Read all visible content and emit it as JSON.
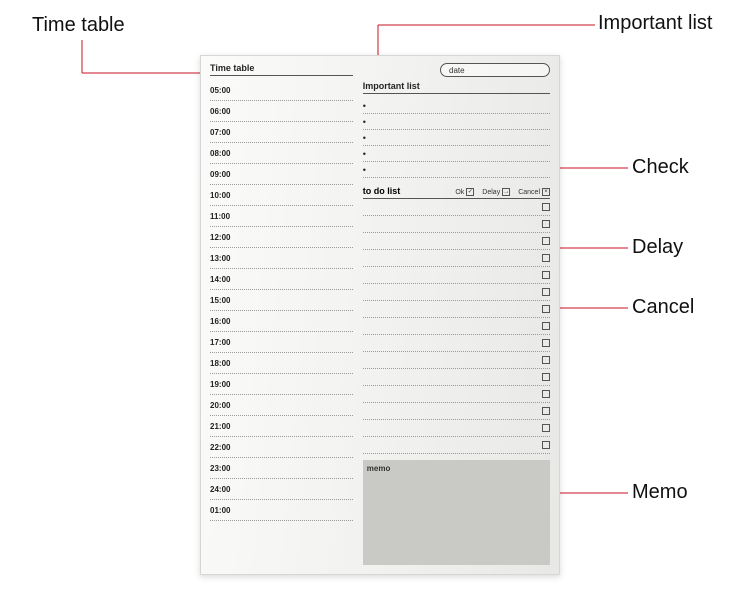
{
  "annotations": {
    "timetable": "Time table",
    "important": "Important list",
    "check": "Check",
    "delay": "Delay",
    "cancel": "Cancel",
    "memo": "Memo"
  },
  "planner": {
    "date_label": "date",
    "timetable": {
      "title": "Time table",
      "hours": [
        "05:00",
        "06:00",
        "07:00",
        "08:00",
        "09:00",
        "10:00",
        "11:00",
        "12:00",
        "13:00",
        "14:00",
        "15:00",
        "16:00",
        "17:00",
        "18:00",
        "19:00",
        "20:00",
        "21:00",
        "22:00",
        "23:00",
        "24:00",
        "01:00"
      ]
    },
    "important": {
      "title": "Important list",
      "rows": 5
    },
    "todo": {
      "title": "to do list",
      "legend": {
        "ok": "Ok",
        "delay": "Delay",
        "cancel": "Cancel"
      },
      "symbols": {
        "ok": "✓",
        "delay": "→",
        "cancel": "×"
      },
      "rows": 15
    },
    "memo_label": "memo"
  }
}
